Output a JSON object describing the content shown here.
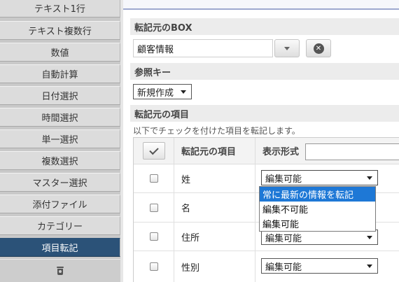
{
  "sidebar": {
    "items": [
      {
        "label": "テキスト1行"
      },
      {
        "label": "テキスト複数行"
      },
      {
        "label": "数値"
      },
      {
        "label": "自動計算"
      },
      {
        "label": "日付選択"
      },
      {
        "label": "時間選択"
      },
      {
        "label": "単一選択"
      },
      {
        "label": "複数選択"
      },
      {
        "label": "マスター選択"
      },
      {
        "label": "添付ファイル"
      },
      {
        "label": "カテゴリー"
      },
      {
        "label": "項目転記"
      }
    ],
    "active_index": 11,
    "bottom_icon": "trash-icon"
  },
  "source_box": {
    "heading": "転記元のBOX",
    "value": "顧客情報",
    "dropdown_icon": "chevron-down-icon",
    "clear_icon": "clear-circle-icon",
    "clear_glyph": "✕"
  },
  "reference_key": {
    "heading": "参照キー",
    "selected": "新規作成"
  },
  "source_items": {
    "heading": "転記元の項目",
    "note": "以下でチェックを付けた項目を転記します。",
    "columns": [
      "転記元の項目",
      "表示形式"
    ],
    "rows": [
      {
        "name": "姓",
        "format": "編集可能"
      },
      {
        "name": "名",
        "format": ""
      },
      {
        "name": "住所",
        "format": "編集可能"
      },
      {
        "name": "性別",
        "format": "編集可能"
      }
    ],
    "dropdown_options": [
      {
        "label": "常に最新の情報を転記",
        "highlighted": true
      },
      {
        "label": "編集不可能",
        "highlighted": false
      },
      {
        "label": "編集可能",
        "highlighted": false
      }
    ]
  },
  "colors": {
    "sidebar_active": "#2b5278",
    "dropdown_highlight": "#1e78d6",
    "top_border": "#9ea9cf"
  }
}
